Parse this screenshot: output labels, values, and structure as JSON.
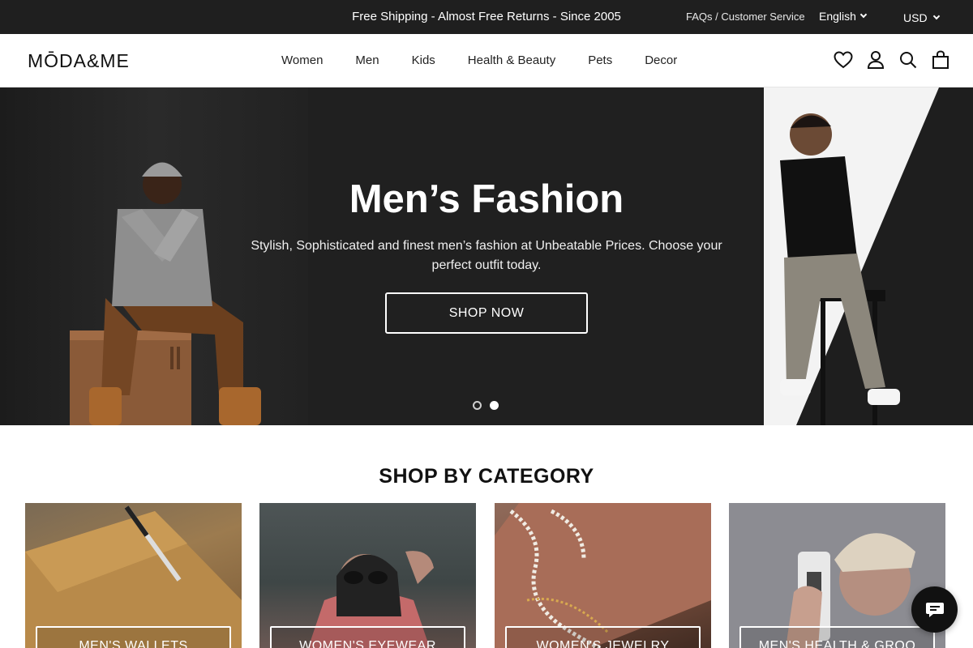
{
  "announcement": {
    "promo": "Free Shipping - Almost Free Returns - Since 2005",
    "faq_link": "FAQs / Customer Service",
    "language": "English",
    "currency": "USD"
  },
  "header": {
    "logo": "MŌDA&ME",
    "nav": [
      "Women",
      "Men",
      "Kids",
      "Health & Beauty",
      "Pets",
      "Decor"
    ],
    "icons": [
      "heart-icon",
      "account-icon",
      "search-icon",
      "bag-icon"
    ]
  },
  "hero": {
    "title": "Men’s Fashion",
    "subtitle": "Stylish, Sophisticated and finest men’s fashion at Unbeatable Prices. Choose your perfect outfit today.",
    "cta": "SHOP NOW",
    "slides": 2,
    "active_slide": 2
  },
  "categories": {
    "title": "SHOP BY CATEGORY",
    "items": [
      {
        "label": "MEN'S WALLETS"
      },
      {
        "label": "WOMEN'S EYEWEAR"
      },
      {
        "label": "WOMEN'S JEWELRY"
      },
      {
        "label": "MEN'S HEALTH & GROO"
      }
    ]
  },
  "chat": {
    "icon": "chat-icon"
  },
  "colors": {
    "topbar": "#1f1f1f",
    "hero_bg": "#202020",
    "accent": "#111111"
  }
}
